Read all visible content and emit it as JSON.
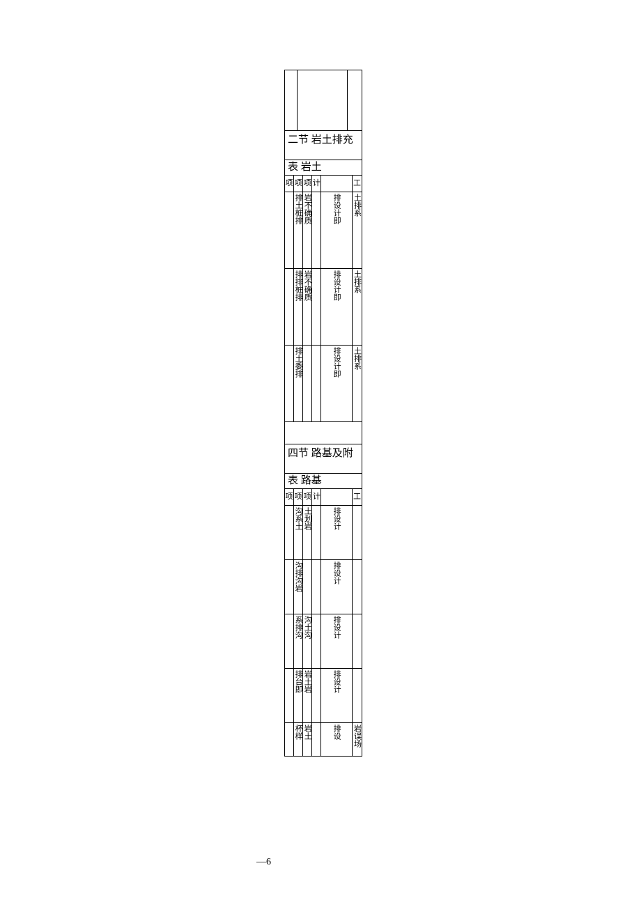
{
  "section_a": {
    "title": "二节 岩土排充",
    "subtitle": "表 岩土",
    "headers": [
      "项",
      "项",
      "项",
      "计",
      "",
      "工"
    ],
    "rows": [
      {
        "c1": "",
        "c2": "排土桩排",
        "c3": "岩不确质",
        "c4": "",
        "c5": "排设计即",
        "c6": "土排系"
      },
      {
        "c1": "",
        "c2": "排排桩排",
        "c3": "岩不确质",
        "c4": "",
        "c5": "排设计即",
        "c6": "土排系"
      },
      {
        "c1": "",
        "c2": "排土委排",
        "c3": "",
        "c4": "",
        "c5": "排设计即",
        "c6": "土排系"
      }
    ]
  },
  "section_b": {
    "title": "四节 路基及附",
    "subtitle": "表 路基",
    "headers": [
      "项",
      "项",
      "项",
      "计",
      "",
      "工"
    ],
    "rows": [
      {
        "c1": "",
        "c2": "沟系土",
        "c3": "土划岩",
        "c4": "",
        "c5": "排设计",
        "c6": ""
      },
      {
        "c1": "",
        "c2": "沟排沟岩",
        "c3": "",
        "c4": "",
        "c5": "排设计",
        "c6": ""
      },
      {
        "c1": "",
        "c2": "系排沟",
        "c3": "沟土沟",
        "c4": "",
        "c5": "排设计",
        "c6": ""
      },
      {
        "c1": "",
        "c2": "排台即",
        "c3": "岩土岩",
        "c4": "",
        "c5": "排设计",
        "c6": ""
      },
      {
        "c1": "",
        "c2": "杯样",
        "c3": "岩土",
        "c4": "",
        "c5": "排设",
        "c6": "岩误场"
      }
    ]
  },
  "page_number": "—6"
}
